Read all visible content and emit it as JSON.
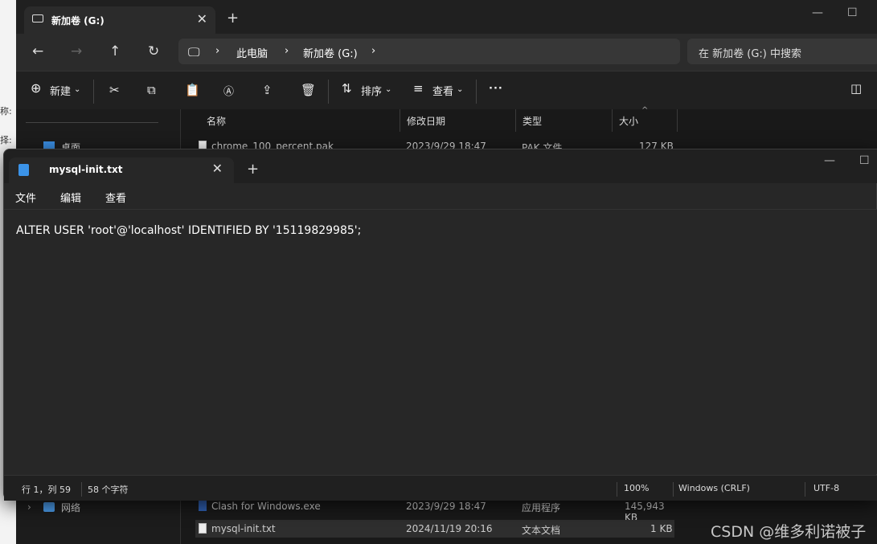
{
  "explorer": {
    "tab_title": "新加卷 (G:)",
    "nav": {
      "breadcrumb": [
        "此电脑",
        "新加卷 (G:)"
      ],
      "search_placeholder": "在 新加卷 (G:) 中搜索"
    },
    "commands": {
      "new": "新建",
      "sort": "排序",
      "view": "查看",
      "more": "···"
    },
    "sidebar": {
      "desktop": "桌面",
      "network": "网络"
    },
    "columns": [
      "名称",
      "修改日期",
      "类型",
      "大小"
    ],
    "files": [
      {
        "name": "chrome_100_percent.pak",
        "date": "2023/9/29 18:47",
        "type": "PAK 文件",
        "size": "127 KB"
      },
      {
        "name": "Clash for Windows.exe",
        "date": "2023/9/29 18:47",
        "type": "应用程序",
        "size": "145,943 KB"
      },
      {
        "name": "mysql-init.txt",
        "date": "2024/11/19 20:16",
        "type": "文本文档",
        "size": "1 KB"
      }
    ],
    "side_labels": [
      "称:",
      "择:"
    ]
  },
  "notepad": {
    "tab_title": "mysql-init.txt",
    "menu": [
      "文件",
      "编辑",
      "查看"
    ],
    "content": "ALTER USER 'root'@'localhost' IDENTIFIED BY '15119829985';",
    "status": {
      "position": "行 1，列 59",
      "chars": "58 个字符",
      "zoom": "100%",
      "eol": "Windows (CRLF)",
      "encoding": "UTF-8"
    }
  },
  "watermark": "CSDN @维多利诺被子"
}
